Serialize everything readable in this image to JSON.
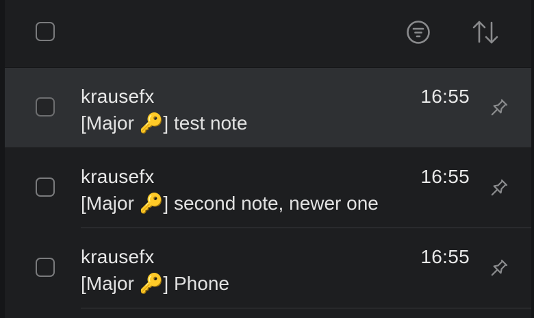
{
  "toolbar": {
    "select_all_checked": false,
    "filter_icon": "filter-lines-icon",
    "sort_icon": "sort-arrows-icon"
  },
  "notes": [
    {
      "sender": "krausefx",
      "time": "16:55",
      "subject": "[Major 🔑] test note",
      "selected": true,
      "pinned": false
    },
    {
      "sender": "krausefx",
      "time": "16:55",
      "subject": "[Major 🔑] second note, newer one",
      "selected": false,
      "pinned": false
    },
    {
      "sender": "krausefx",
      "time": "16:55",
      "subject": "[Major 🔑] Phone",
      "selected": false,
      "pinned": false
    }
  ],
  "colors": {
    "background": "#1d1e20",
    "selected_row": "#2e3033",
    "text": "#e8e8e8",
    "icon": "#8a8b8d"
  }
}
